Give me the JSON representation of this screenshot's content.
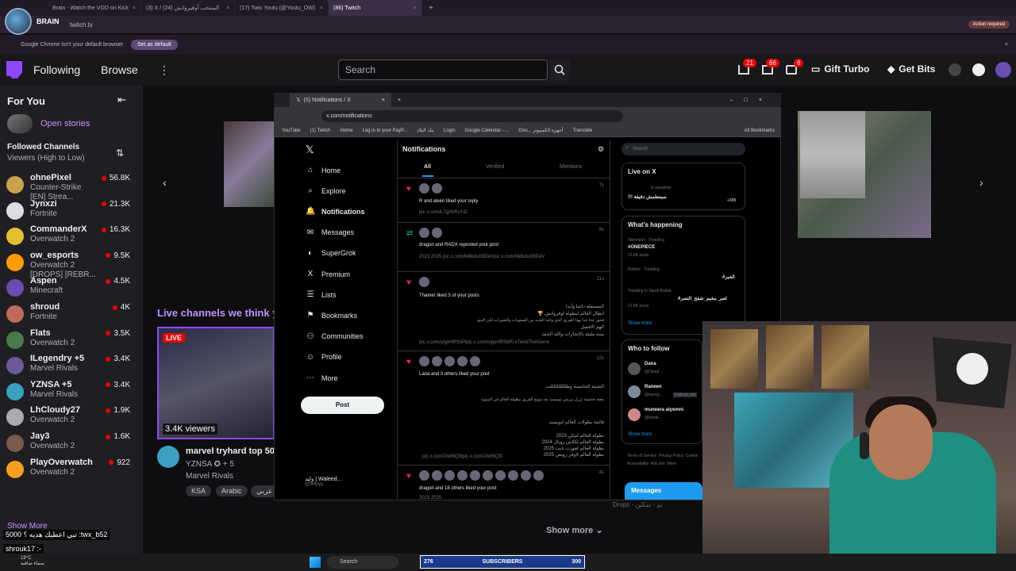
{
  "browser": {
    "tabs": [
      {
        "label": "Brain - Watch the VOD on Kick",
        "active": false
      },
      {
        "label": "(3) X / المنتخب أوفيرواتش (24)",
        "active": false
      },
      {
        "label": "(17) Twis Youtu (@Youtu_OW)",
        "active": false
      },
      {
        "label": "(86) Twitch",
        "active": true
      }
    ],
    "address": "twitch.tv",
    "default_browser_msg": "Google Chrome isn't your default browser",
    "set_default_label": "Set as default",
    "action_required": "Action required"
  },
  "streamer_overlay": {
    "name": "BRAIN"
  },
  "twitch": {
    "nav": {
      "following": "Following",
      "browse": "Browse",
      "more": "⋮"
    },
    "search_placeholder": "Search",
    "badges": {
      "inbox": "21",
      "notifications": "66",
      "whispers": "6"
    },
    "gift_turbo": "Gift Turbo",
    "get_bits": "Get Bits",
    "sidebar": {
      "for_you": "For You",
      "open_stories": "Open stories",
      "followed_channels": "Followed Channels",
      "sort_label": "Viewers (High to Low)",
      "show_more": "Show More",
      "channels": [
        {
          "name": "ohnePixel",
          "game": "Counter-Strike",
          "extra": "[EN] Strea...",
          "viewers": "56.8K",
          "color": "#c9a24b"
        },
        {
          "name": "Jynxzi",
          "game": "Fortnite",
          "viewers": "21.3K",
          "color": "#dddddd"
        },
        {
          "name": "CommanderX",
          "game": "Overwatch 2",
          "viewers": "16.3K",
          "color": "#e0c030"
        },
        {
          "name": "ow_esports",
          "game": "Overwatch 2",
          "extra": "[DROPS] [REBR...",
          "viewers": "9.5K",
          "color": "#ff9c00"
        },
        {
          "name": "Aspen",
          "game": "Minecraft",
          "viewers": "4.5K",
          "color": "#6a4cb3"
        },
        {
          "name": "shroud",
          "game": "Fortnite",
          "viewers": "4K",
          "color": "#c06a5a"
        },
        {
          "name": "Flats",
          "game": "Overwatch 2",
          "viewers": "3.5K",
          "color": "#4a7a4a"
        },
        {
          "name": "ILegendry +5",
          "game": "Marvel Rivals",
          "viewers": "3.4K",
          "color": "#6a5a9a"
        },
        {
          "name": "YZNSA +5",
          "game": "Marvel Rivals",
          "viewers": "3.4K",
          "color": "#3aa0c0"
        },
        {
          "name": "LhCloudy27",
          "game": "Overwatch 2",
          "viewers": "1.9K",
          "color": "#aaaaaa"
        },
        {
          "name": "Jay3",
          "game": "Overwatch 2",
          "viewers": "1.6K",
          "color": "#7a5a4a"
        },
        {
          "name": "PlayOverwatch",
          "game": "Overwatch 2",
          "viewers": "922",
          "color": "#f99e1a"
        }
      ]
    },
    "main": {
      "live_channels_heading": "Live channels we think y",
      "live_badge": "LIVE",
      "viewers": "3.4K viewers",
      "stream_title": "marvel tryhard top 50",
      "stream_channel": "YZNSA ✪ + 5",
      "stream_game": "Marvel Rivals",
      "tags": [
        "KSA",
        "Arabic",
        "عربي"
      ],
      "show_more": "Show more"
    },
    "chat_overlay": [
      "تبي اعطيك هديه ؟ 5000 :twx_b52",
      "shrouk17 :-"
    ]
  },
  "x_window": {
    "tab_title": "(5) Notifications / X",
    "url": "x.com/notifications",
    "bookmarks": [
      "YouTube",
      "(1) Twitch",
      "Home",
      "Log in to your PayP...",
      "بنك البلاد",
      "Login",
      "Google Calendar - ...",
      "Goo... أجهزة الكمبيوتر",
      "Translate",
      "All Bookmarks"
    ],
    "nav": [
      {
        "label": "Home",
        "icon": "⌂"
      },
      {
        "label": "Explore",
        "icon": "⌕"
      },
      {
        "label": "Notifications",
        "icon": "🔔"
      },
      {
        "label": "Messages",
        "icon": "✉"
      },
      {
        "label": "SuperGrok",
        "icon": "◐"
      },
      {
        "label": "Premium",
        "icon": "X"
      },
      {
        "label": "Lists",
        "icon": "☰"
      },
      {
        "label": "Bookmarks",
        "icon": "⚑"
      },
      {
        "label": "Communities",
        "icon": "⚇"
      },
      {
        "label": "Profile",
        "icon": "☺"
      },
      {
        "label": "More",
        "icon": "⋯"
      }
    ],
    "post_button": "Post",
    "account": {
      "name": "وليد | Waleed...",
      "handle": "@Wlljiyy"
    },
    "notifications_title": "Notifications",
    "tabs": [
      "All",
      "Verified",
      "Mentions"
    ],
    "items": [
      {
        "text": "R and aleen liked your reply",
        "sub": "pic.x.com/L7gXhRsYZl",
        "time": "7s",
        "kind": "like"
      },
      {
        "text": "dragon and RADX reposted your post",
        "sub": "2023 2025 pic.x.com/MdkduX8DeVpic.x.com/MdkduX8DeV",
        "time": "9s",
        "kind": "repost"
      },
      {
        "text": "Thamer liked 3 of your posts",
        "arabic": [
          "المستقلة دائما وأبدا",
          "ابطال العالم لبطولة اوفرواتش 🏆",
          "فخور جدا جدا بهذا الفريق الذي واجه العديد من الصعوبات والتغييرات لكن النيتو",
          "الهم الافضل",
          "سنة مليئة بالإنجازات والله الحمد"
        ],
        "sub": "pic.x.com/sIgxHRSbPlpic.x.com/sIgxHRSbPl #TwistTheGame",
        "time": "11s",
        "kind": "like"
      },
      {
        "text": "Lana and 3 others liked your post",
        "arabic": [
          "النجمة الخامسة وطللللللللللت",
          "بعجة خامسة ترزل بيريس تونيسند بعد تتويج الفريق ببطولة العالم في السويد",
          "قائمة بطولات العالم لتويسند",
          "بطولة العالم لتيكن 2023",
          "بطولة العالم لكلاش رويال 2024",
          "بطولة العالم لفورت نايت 2025",
          "بطولة العالم لاوفر روتش 2025"
        ],
        "sub": "pic.x.com/2lw5tQ3lpic.x.com/2lw5tQ3l",
        "time": "12s",
        "kind": "like"
      },
      {
        "text": "dragon and 18 others liked your post",
        "sub": "2023 2025",
        "time": "4s",
        "kind": "like"
      }
    ],
    "search_placeholder": "Search",
    "live_on_x": {
      "title": "Live on X",
      "speaker_status": "is speaking",
      "space_title": "!!! سيعطمش دقيقة",
      "listeners": "+305"
    },
    "whats_happening": {
      "title": "What’s happening",
      "trends": [
        {
          "context": "Television · Trending",
          "name": "#ONEPIECE",
          "posts": "23.6K posts"
        },
        {
          "context": "Politics · Trending",
          "name": "#الخبر",
          "posts": ""
        },
        {
          "context": "Trending in Saudi Arabia",
          "name": "#لعبر_مخيم_شفح_النصر",
          "posts": "21.8K posts"
        }
      ],
      "show_more": "Show more"
    },
    "who_to_follow": {
      "title": "Who to follow",
      "users": [
        {
          "name": "Dana",
          "handle": "@Danal..."
        },
        {
          "name": "Raneen",
          "handle": "@kanop..."
        },
        {
          "name": "muneera alyemni",
          "handle": "@omde..."
        }
      ],
      "follows_you": "Follows you",
      "show_more": "Show more"
    },
    "footer": [
      "Terms of Service",
      "Privacy Policy",
      "Cookie",
      "Accessibility",
      "Ads info",
      "More"
    ],
    "messages_label": "Messages"
  },
  "overlay_subscribers": {
    "current": "276",
    "label": "SUBSCRIBERS",
    "goal": "300"
  },
  "drops_hint": "Drops · تم · تمكين",
  "taskbar": {
    "search": "Search",
    "weather_temp": "19°C",
    "weather_desc": "سماء صافية"
  }
}
